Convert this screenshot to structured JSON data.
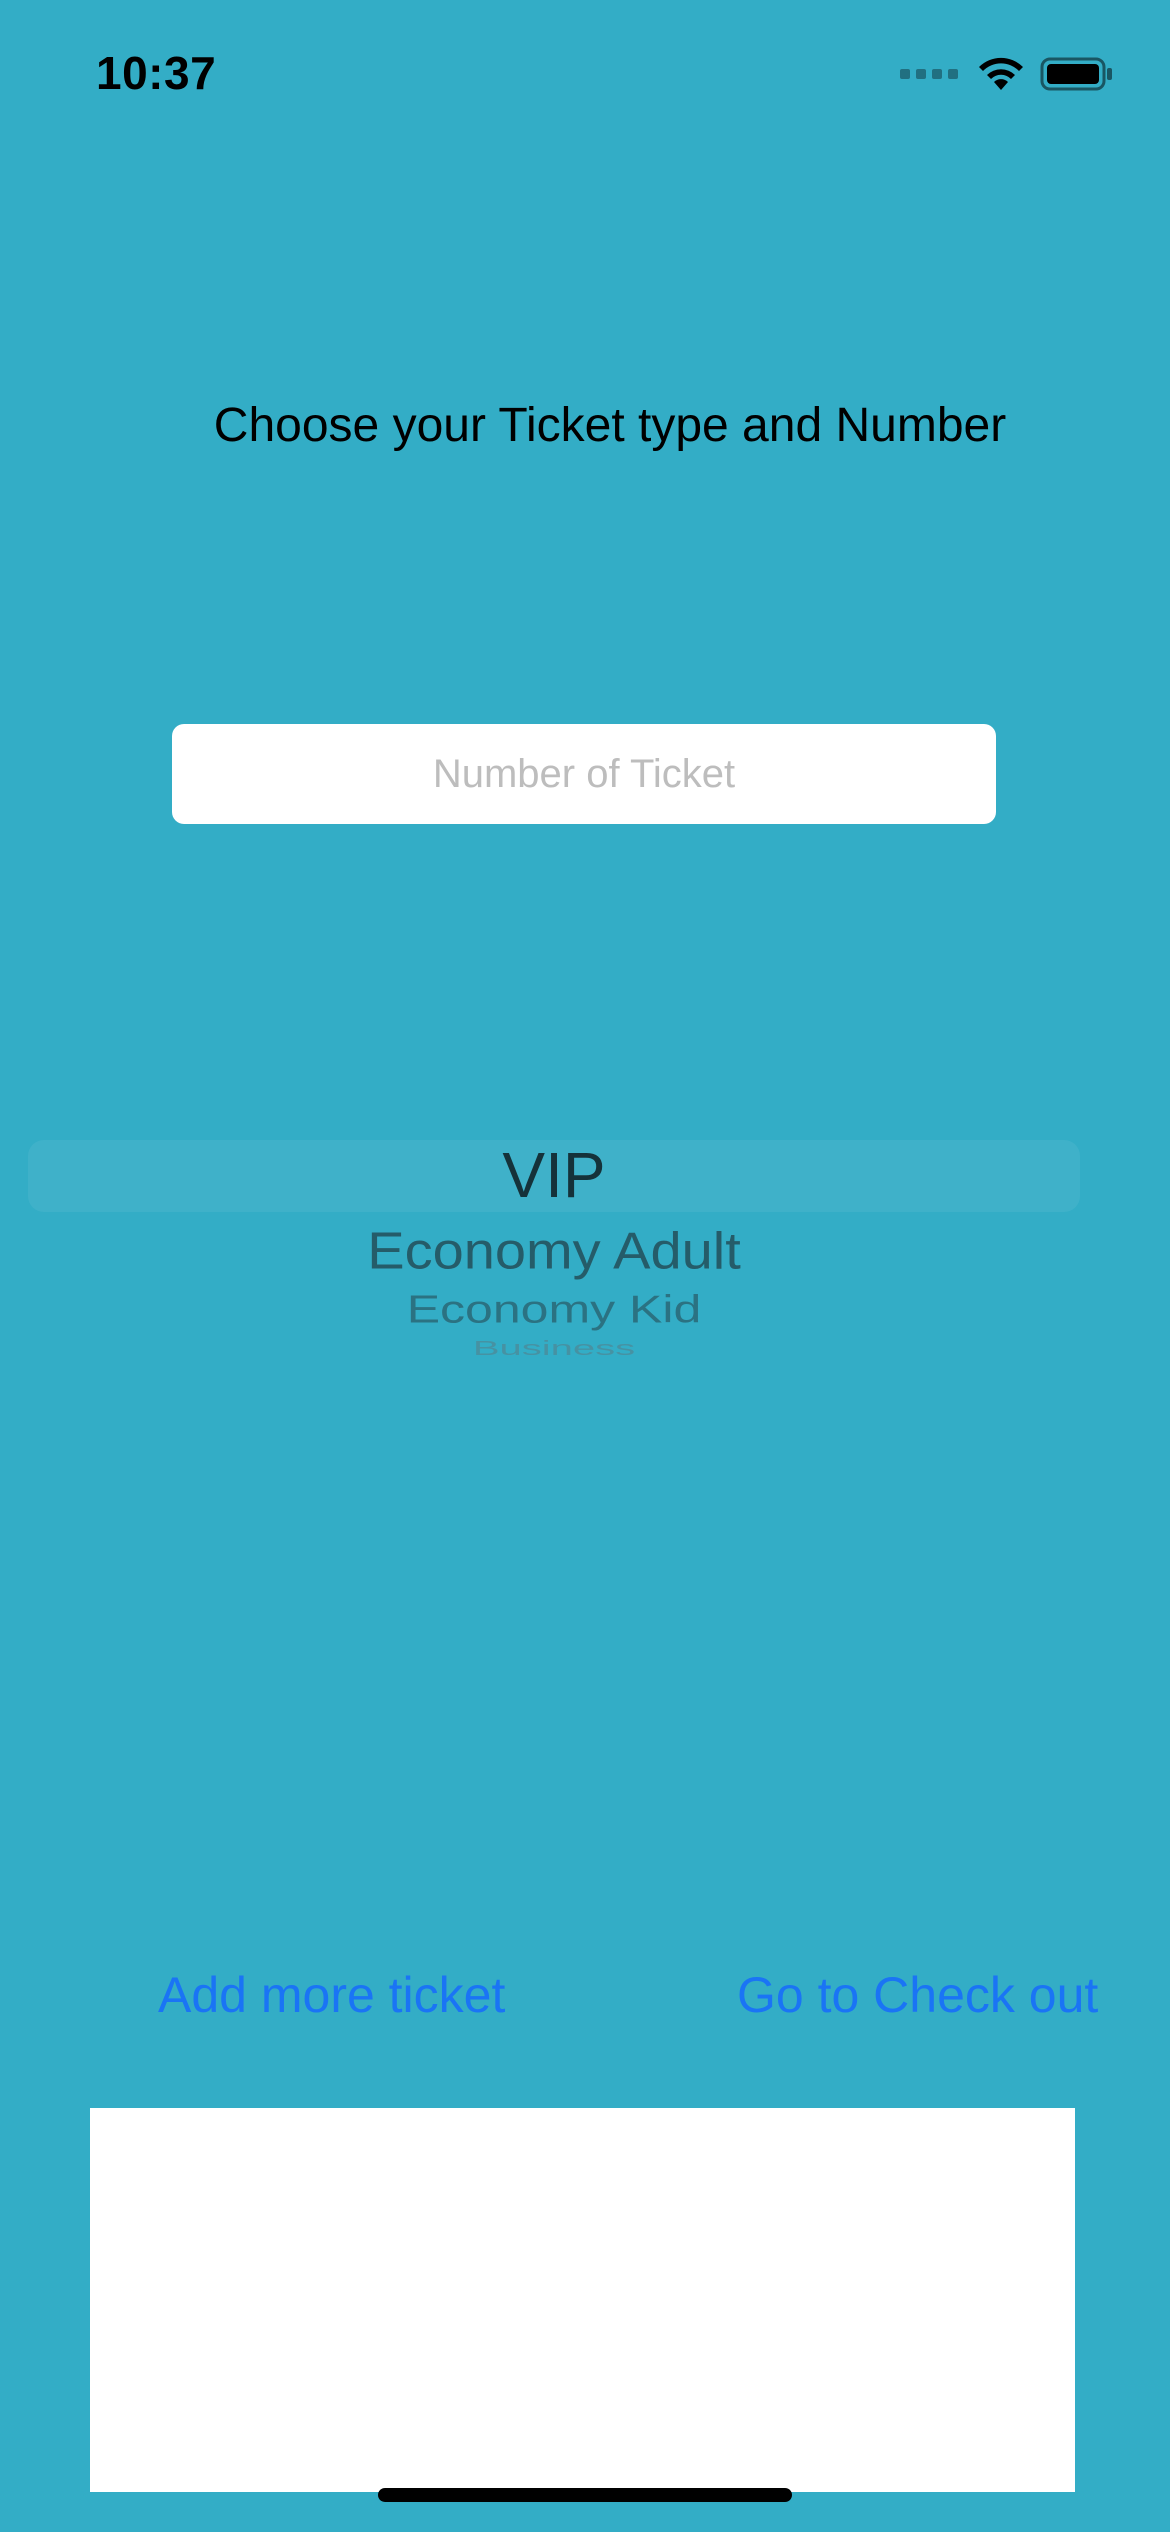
{
  "status_bar": {
    "time": "10:37",
    "icons": [
      "cellular-signal-icon",
      "wifi-icon",
      "battery-icon"
    ]
  },
  "screen": {
    "title": "Choose your Ticket type and Number",
    "input": {
      "placeholder": "Number of Ticket",
      "value": ""
    },
    "picker": {
      "selected": "VIP",
      "options": [
        "VIP",
        "Economy Adult",
        "Economy Kid",
        "Business"
      ]
    },
    "buttons": {
      "add_more": "Add more ticket",
      "checkout": "Go to Check out"
    }
  },
  "colors": {
    "background": "#33adc6",
    "link": "#1a74f5",
    "panel": "#ffffff"
  }
}
